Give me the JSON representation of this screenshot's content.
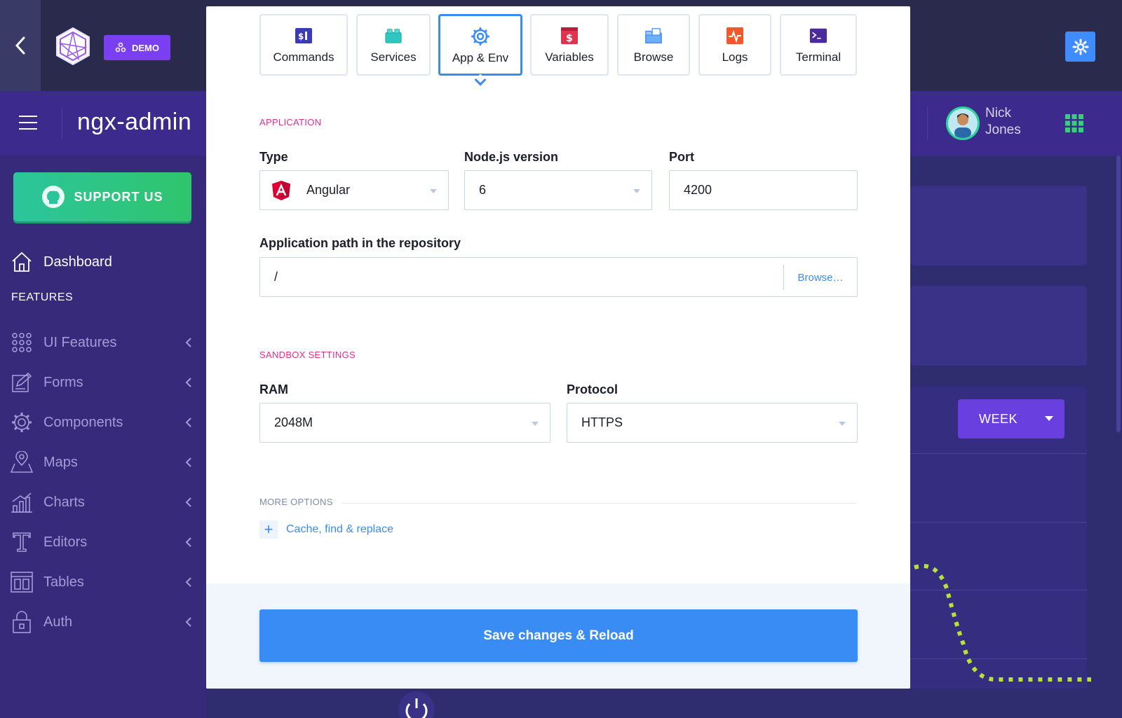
{
  "topbar": {
    "demo_label": "DEMO"
  },
  "header": {
    "app_title": "ngx-admin",
    "user_first": "Nick",
    "user_last": "Jones"
  },
  "sidebar": {
    "support_label": "SUPPORT US",
    "dashboard": "Dashboard",
    "section_features": "FEATURES",
    "items": [
      {
        "label": "UI Features",
        "icon": "grid-dots-icon"
      },
      {
        "label": "Forms",
        "icon": "edit-icon"
      },
      {
        "label": "Components",
        "icon": "gear-icon"
      },
      {
        "label": "Maps",
        "icon": "map-pin-icon"
      },
      {
        "label": "Charts",
        "icon": "bar-chart-icon"
      },
      {
        "label": "Editors",
        "icon": "text-icon"
      },
      {
        "label": "Tables",
        "icon": "table-icon"
      },
      {
        "label": "Auth",
        "icon": "lock-icon"
      }
    ]
  },
  "main": {
    "week_label": "WEEK"
  },
  "modal": {
    "tabs": [
      {
        "label": "Commands",
        "icon": "commands-icon",
        "color": "#3b3bb8"
      },
      {
        "label": "Services",
        "icon": "services-icon",
        "color": "#2fc6c0"
      },
      {
        "label": "App & Env",
        "icon": "app-env-icon",
        "color": "#3a8cf5"
      },
      {
        "label": "Variables",
        "icon": "variables-icon",
        "color": "#e0334f"
      },
      {
        "label": "Browse",
        "icon": "browse-icon",
        "color": "#3a8cf5"
      },
      {
        "label": "Logs",
        "icon": "logs-icon",
        "color": "#f05a2a"
      },
      {
        "label": "Terminal",
        "icon": "terminal-icon",
        "color": "#4a2a9c"
      }
    ],
    "application": {
      "title": "APPLICATION",
      "type_label": "Type",
      "type_value": "Angular",
      "node_label": "Node.js version",
      "node_value": "6",
      "port_label": "Port",
      "port_value": "4200",
      "path_label": "Application path in the repository",
      "path_value": "/",
      "browse_label": "Browse…"
    },
    "sandbox": {
      "title": "SANDBOX SETTINGS",
      "ram_label": "RAM",
      "ram_value": "2048M",
      "protocol_label": "Protocol",
      "protocol_value": "HTTPS"
    },
    "more": {
      "title": "MORE OPTIONS",
      "cache_link": "Cache, find & replace"
    },
    "save_label": "Save changes & Reload"
  },
  "colors": {
    "accent": "#3a8cf5",
    "section_title": "#e42e8c",
    "sidebar_bg": "#382a7a",
    "support_green": "#2cc59b"
  }
}
